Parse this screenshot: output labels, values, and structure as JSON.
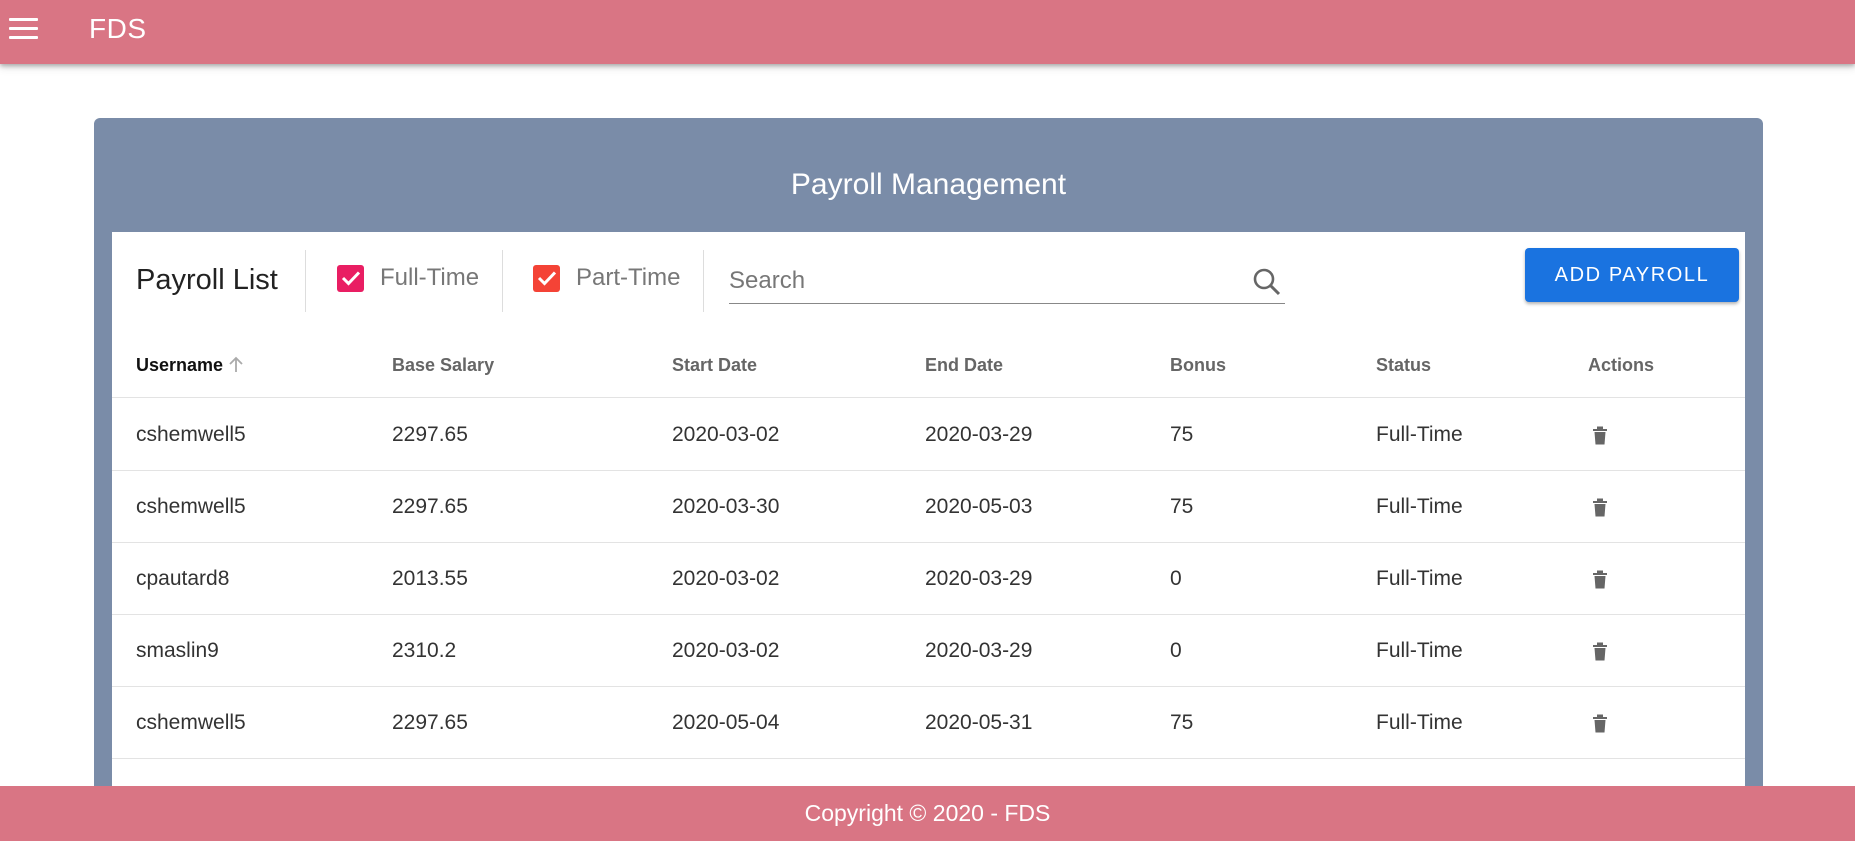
{
  "app": {
    "title": "FDS"
  },
  "card": {
    "title": "Payroll Management"
  },
  "toolbar": {
    "list_title": "Payroll List",
    "filters": [
      {
        "label": "Full-Time",
        "checked": true,
        "color": "#e91e63"
      },
      {
        "label": "Part-Time",
        "checked": true,
        "color": "#f44336"
      }
    ],
    "search": {
      "placeholder": "Search",
      "value": ""
    },
    "add_label": "ADD PAYROLL"
  },
  "table": {
    "columns": [
      "Username",
      "Base Salary",
      "Start Date",
      "End Date",
      "Bonus",
      "Status",
      "Actions"
    ],
    "sorted_column": "Username",
    "sort_direction": "ascending",
    "rows": [
      [
        "cshemwell5",
        "2297.65",
        "2020-03-02",
        "2020-03-29",
        "75",
        "Full-Time"
      ],
      [
        "cshemwell5",
        "2297.65",
        "2020-03-30",
        "2020-05-03",
        "75",
        "Full-Time"
      ],
      [
        "cpautard8",
        "2013.55",
        "2020-03-02",
        "2020-03-29",
        "0",
        "Full-Time"
      ],
      [
        "smaslin9",
        "2310.2",
        "2020-03-02",
        "2020-03-29",
        "0",
        "Full-Time"
      ],
      [
        "cshemwell5",
        "2297.65",
        "2020-05-04",
        "2020-05-31",
        "75",
        "Full-Time"
      ]
    ]
  },
  "footer": {
    "text": "Copyright © 2020 - FDS"
  },
  "colors": {
    "appbar": "#d97584",
    "card": "#7a8ca8",
    "primary_button": "#1a73e0"
  }
}
